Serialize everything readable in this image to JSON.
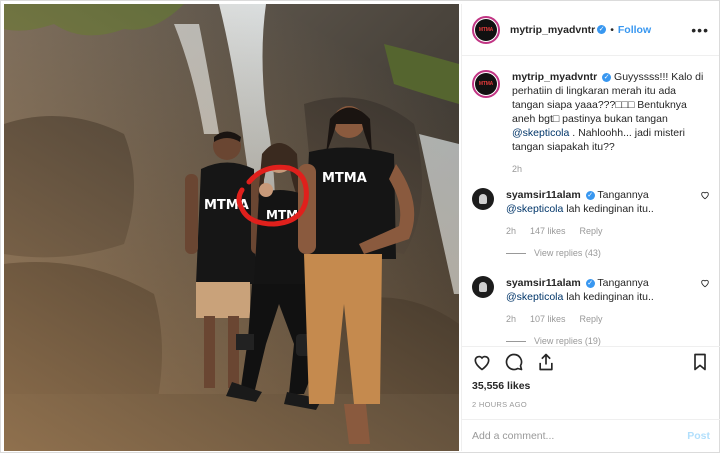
{
  "post": {
    "account": "mytrip_myadvntr",
    "avatar_text": "MTMA",
    "follow_label": "Follow",
    "more_icon": "more-options-icon",
    "caption": {
      "part1": "Guyyssss!!! Kalo di perhatiin di lingkaran merah itu ada tangan siapa yaaa???□□□ Bentuknya aneh bgt□ pastinya bukan tangan ",
      "mention": "@skepticola",
      "part2": " . Nahloohh... jadi misteri tangan siapakah itu??",
      "time": "2h"
    },
    "comments": [
      {
        "user": "syamsir11alam",
        "text_pre": "Tangannya ",
        "mention": "@skepticola",
        "text_post": " lah kedinginan itu..",
        "time": "2h",
        "likes": "147 likes",
        "reply_label": "Reply",
        "view_replies": "View replies (43)"
      },
      {
        "user": "syamsir11alam",
        "text_pre": "Tangannya ",
        "mention": "@skepticola",
        "text_post": " lah kedinginan itu..",
        "time": "2h",
        "likes": "107 likes",
        "reply_label": "Reply",
        "view_replies": "View replies (19)"
      }
    ],
    "likes": "35,556 likes",
    "posted_ago": "2 HOURS AGO",
    "add_comment_placeholder": "Add a comment...",
    "post_label": "Post",
    "photo": {
      "shirt_text": "MTMA",
      "icons": [
        "heart-icon",
        "comment-icon",
        "share-icon",
        "bookmark-icon"
      ]
    },
    "colors": {
      "link": "#3897f0",
      "mention": "#003569",
      "muted": "#999999",
      "circle": "#e0201c"
    }
  }
}
